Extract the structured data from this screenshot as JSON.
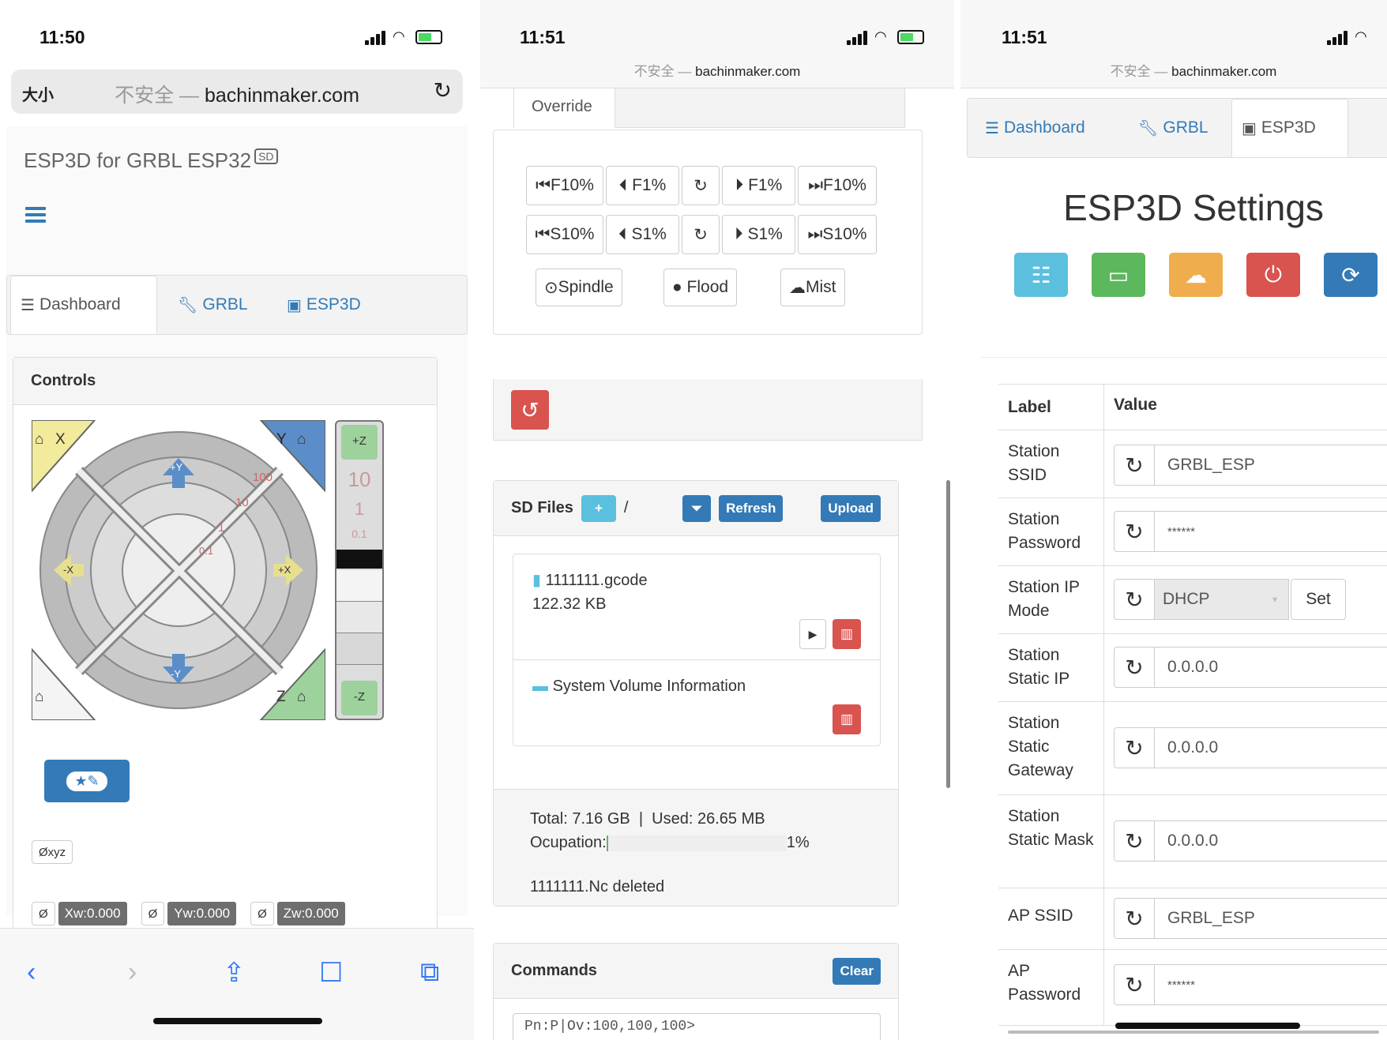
{
  "phone1": {
    "time": "11:50",
    "url_prefix": "不安全 —",
    "url_domain": "bachinmaker.com",
    "text_size_label": "大小",
    "app_title": "ESP3D for GRBL ESP32",
    "sd_badge": "SD",
    "tabs": [
      "Dashboard",
      "GRBL",
      "ESP3D"
    ],
    "controls_title": "Controls",
    "jog_labels": {
      "x_home": "X",
      "y_home": "Y",
      "z_home": "Z",
      "plus_y": "+Y",
      "minus_y": "-Y",
      "plus_x": "+X",
      "minus_x": "-X",
      "plus_z": "+Z",
      "minus_z": "-Z",
      "steps": [
        "100",
        "10",
        "1",
        "0.1"
      ],
      "z_steps": [
        "10",
        "1",
        "0.1"
      ]
    },
    "zero_xyz": "Øxyz",
    "zero_symbol": "Ø",
    "positions": [
      "Xw:0.000",
      "Yw:0.000",
      "Zw:0.000"
    ]
  },
  "phone2": {
    "time": "11:51",
    "url_prefix": "不安全 —",
    "url_domain": "bachinmaker.com",
    "override_tab": "Override",
    "feed_row": [
      "F10%",
      "F1%",
      "",
      "F1%",
      "F10%"
    ],
    "speed_row": [
      "S10%",
      "S1%",
      "",
      "S1%",
      "S10%"
    ],
    "controls": [
      "Spindle",
      "Flood",
      "Mist"
    ],
    "sd_files_title": "SD Files",
    "sd_path": "/",
    "refresh_label": "Refresh",
    "upload_label": "Upload",
    "files": [
      {
        "name": "1111111.gcode",
        "size": "122.32 KB"
      },
      {
        "name": "System Volume Information",
        "size": ""
      }
    ],
    "total": "Total: 7.16 GB",
    "used": "Used: 26.65 MB",
    "ocupation_label": "Ocupation:",
    "ocupation_pct": "1%",
    "ocupation_value": 0.01,
    "status_msg": "1111111.Nc deleted",
    "commands_title": "Commands",
    "clear_label": "Clear",
    "console_line": "Pn:P|Ov:100,100,100>"
  },
  "phone3": {
    "time": "11:51",
    "url_prefix": "不安全 —",
    "url_domain": "bachinmaker.com",
    "tabs": [
      "Dashboard",
      "GRBL",
      "ESP3D"
    ],
    "title": "ESP3D Settings",
    "table_headers": [
      "Label",
      "Value"
    ],
    "settings": [
      {
        "label": "Station SSID",
        "value": "GRBL_ESP"
      },
      {
        "label": "Station Password",
        "value": "******"
      },
      {
        "label": "Station IP Mode",
        "value": "DHCP",
        "set": "Set"
      },
      {
        "label": "Station Static IP",
        "value": "0.0.0.0"
      },
      {
        "label": "Station Static Gateway",
        "value": "0.0.0.0"
      },
      {
        "label": "Station Static Mask",
        "value": "0.0.0.0"
      },
      {
        "label": "AP SSID",
        "value": "GRBL_ESP"
      },
      {
        "label": "AP Password",
        "value": "******"
      }
    ]
  },
  "colors": {
    "primary": "#337ab7",
    "info": "#5bc0de",
    "success": "#5cb85c",
    "warning": "#f0ad4e",
    "danger": "#d9534f"
  }
}
